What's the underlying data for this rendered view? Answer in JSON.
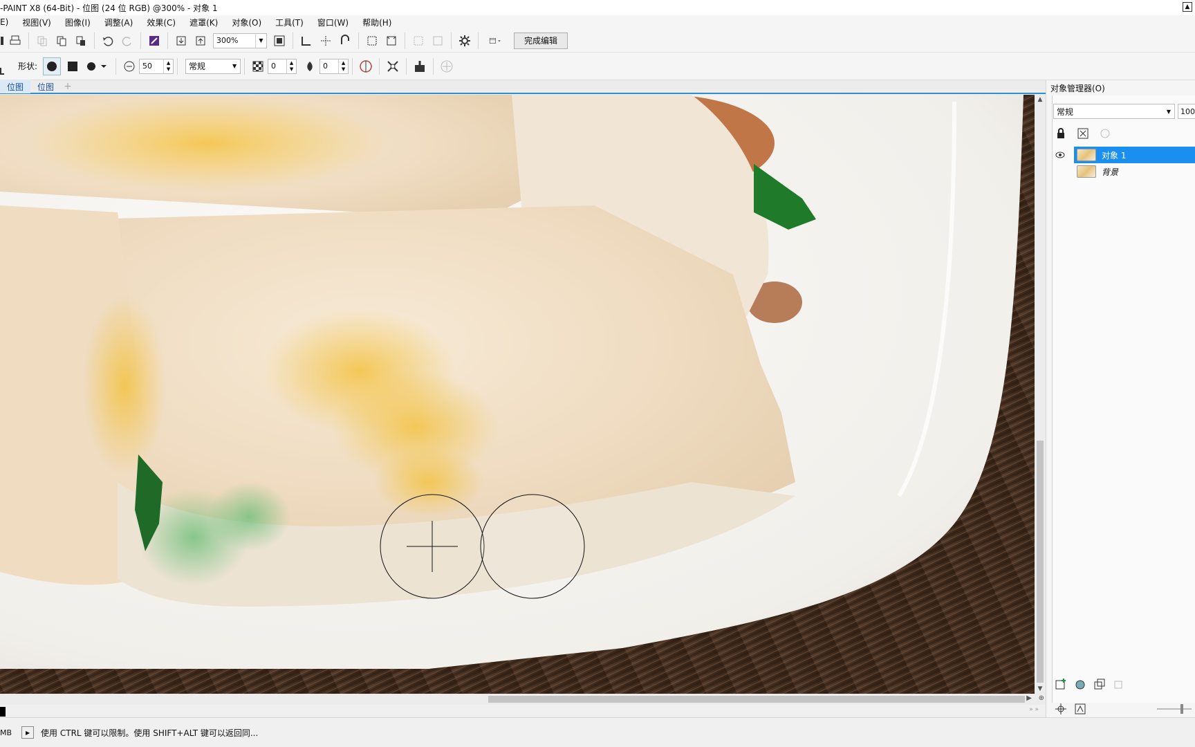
{
  "window": {
    "title": "-PAINT X8 (64-Bit) - 位图 (24 位 RGB) @300% - 对象 1"
  },
  "menu": [
    {
      "label": "E)"
    },
    {
      "label": "视图(V)"
    },
    {
      "label": "图像(I)"
    },
    {
      "label": "调整(A)"
    },
    {
      "label": "效果(C)"
    },
    {
      "label": "遮罩(K)"
    },
    {
      "label": "对象(O)"
    },
    {
      "label": "工具(T)"
    },
    {
      "label": "窗口(W)"
    },
    {
      "label": "帮助(H)"
    }
  ],
  "toolbar": {
    "zoom_value": "300%",
    "finish_edit_label": "完成编辑"
  },
  "propbar": {
    "shape_label": "形状:",
    "nib_size": "50",
    "merge_mode": "常规",
    "transparency": "0",
    "feather": "0"
  },
  "doc_tabs": [
    {
      "label": "位图"
    },
    {
      "label": "位图"
    }
  ],
  "docker": {
    "title": "对象管理器(O)",
    "merge_mode": "常规",
    "opacity": "100",
    "objects": [
      {
        "name": "对象 1",
        "selected": true
      },
      {
        "name": "背景",
        "selected": false
      }
    ]
  },
  "status": {
    "memory": "MB",
    "hint": "使用 CTRL 键可以限制。使用 SHIFT+ALT 键可以返回同..."
  },
  "colors": {
    "accent": "#1b8ff0",
    "tab_underline": "#2b8fd6"
  }
}
